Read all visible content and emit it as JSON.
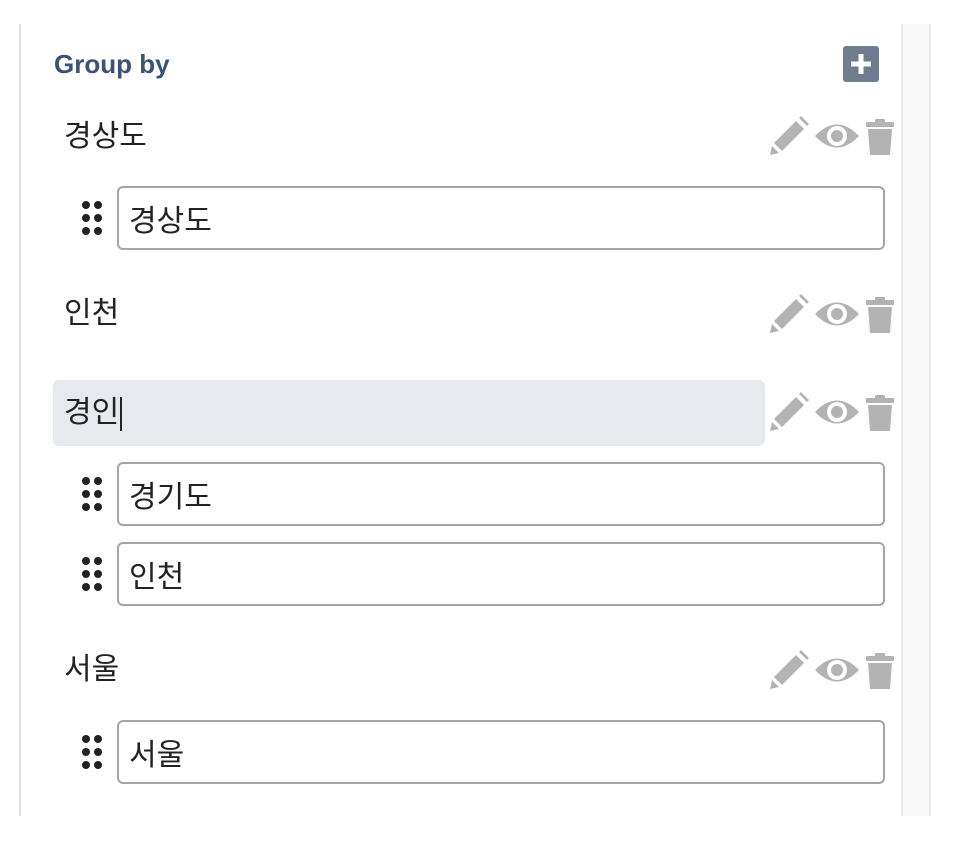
{
  "panel": {
    "title": "Group by",
    "add_icon": "plus-icon",
    "groups": [
      {
        "name": "경상도",
        "editing": false,
        "items": [
          "경상도"
        ]
      },
      {
        "name": "인천",
        "editing": false,
        "items": []
      },
      {
        "name": "경인",
        "editing": true,
        "items": [
          "경기도",
          "인천"
        ]
      },
      {
        "name": "서울",
        "editing": false,
        "items": [
          "서울"
        ]
      }
    ],
    "action_icons": [
      "pencil-icon",
      "eye-icon",
      "trash-icon"
    ],
    "drag_icon": "drag-handle-icon",
    "colors": {
      "title": "#3d5272",
      "add_button": "#6e7c8e",
      "action_icons": "#b3b3b3",
      "editing_background": "#e6e9ed",
      "input_border": "#a5a5a5"
    }
  }
}
